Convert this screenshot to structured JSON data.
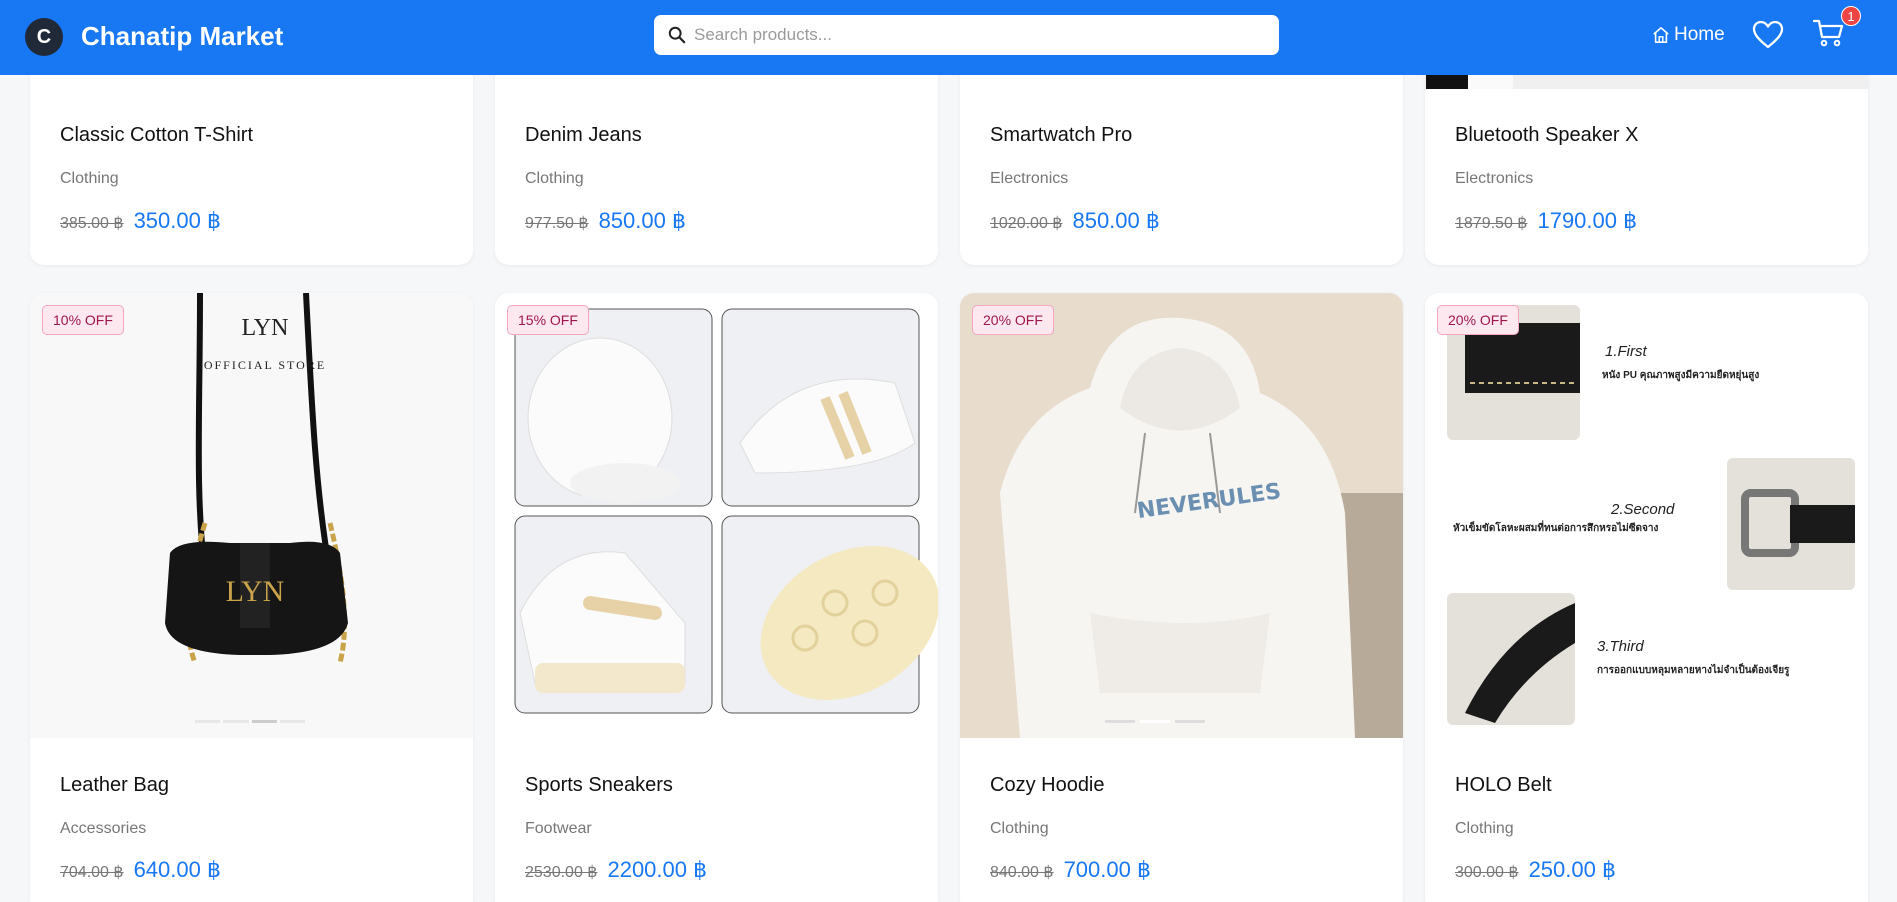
{
  "header": {
    "logo_letter": "C",
    "brand": "Chanatip Market",
    "search_placeholder": "Search products...",
    "home_label": "Home",
    "cart_count": "1",
    "accent": "#1877f2"
  },
  "products_top": [
    {
      "name": "Classic Cotton T-Shirt",
      "category": "Clothing",
      "old_price": "385.00 ฿",
      "price": "350.00 ฿"
    },
    {
      "name": "Denim Jeans",
      "category": "Clothing",
      "old_price": "977.50 ฿",
      "price": "850.00 ฿"
    },
    {
      "name": "Smartwatch Pro",
      "category": "Electronics",
      "old_price": "1020.00 ฿",
      "price": "850.00 ฿"
    },
    {
      "name": "Bluetooth Speaker X",
      "category": "Electronics",
      "old_price": "1879.50 ฿",
      "price": "1790.00 ฿"
    }
  ],
  "products_bottom": [
    {
      "name": "Leather Bag",
      "category": "Accessories",
      "old_price": "704.00 ฿",
      "price": "640.00 ฿",
      "discount": "10% OFF"
    },
    {
      "name": "Sports Sneakers",
      "category": "Footwear",
      "old_price": "2530.00 ฿",
      "price": "2200.00 ฿",
      "discount": "15% OFF"
    },
    {
      "name": "Cozy Hoodie",
      "category": "Clothing",
      "old_price": "840.00 ฿",
      "price": "700.00 ฿",
      "discount": "20% OFF"
    },
    {
      "name": "HOLO Belt",
      "category": "Clothing",
      "old_price": "300.00 ฿",
      "price": "250.00 ฿",
      "discount": "20% OFF"
    }
  ],
  "images": {
    "bag_brand": "LYN",
    "bag_store": "OFFICIAL STORE",
    "hoodie_print": "NEVERULES",
    "belt_step1": "1.First",
    "belt_step2": "2.Second",
    "belt_step3": "3.Third",
    "belt_desc1": "หนัง PU คุณภาพสูงมีความยืดหยุ่นสูง",
    "belt_desc2": "หัวเข็มขัดโลหะผสมที่ทนต่อการสึกหรอไม่ซีดจาง",
    "belt_desc3": "การออกแบบหลุมหลายหางไม่จำเป็นต้องเจียรู"
  }
}
